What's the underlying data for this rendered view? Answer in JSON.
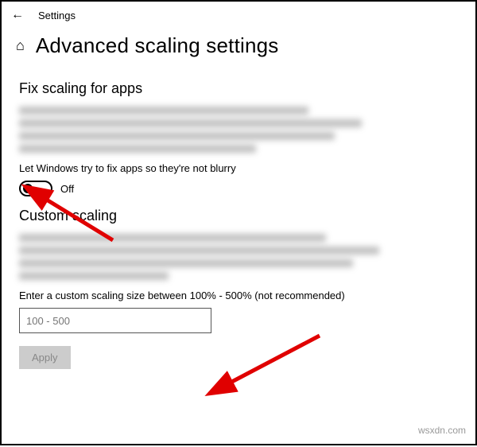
{
  "header": {
    "back_icon": "←",
    "app_title": "Settings"
  },
  "page": {
    "home_icon": "⌂",
    "title": "Advanced scaling settings"
  },
  "section1": {
    "heading": "Fix scaling for apps",
    "toggle_label": "Let Windows try to fix apps so they're not blurry",
    "toggle_state": "Off"
  },
  "section2": {
    "heading": "Custom scaling",
    "input_label": "Enter a custom scaling size between 100% - 500% (not recommended)",
    "input_placeholder": "100 - 500",
    "apply_label": "Apply"
  },
  "watermark": "wsxdn.com"
}
